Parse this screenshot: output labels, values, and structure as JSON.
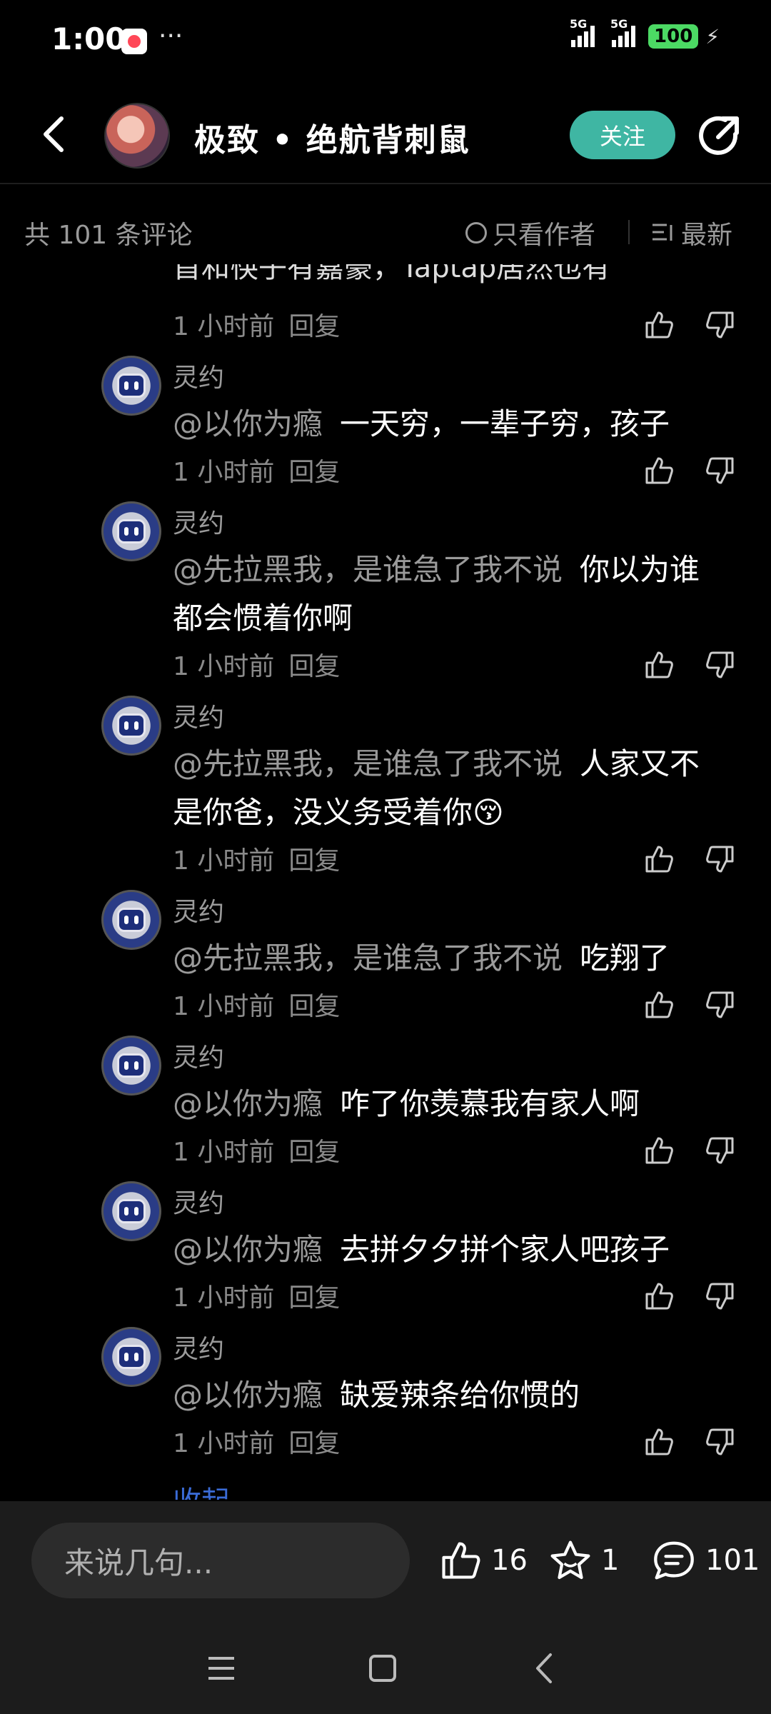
{
  "status": {
    "time": "1:00",
    "more": "···",
    "network1": "5G",
    "network2": "5G",
    "battery": "100"
  },
  "header": {
    "title": "极致 • 绝航背刺鼠",
    "follow_label": "关注"
  },
  "comments_header": {
    "count": "共 101 条评论",
    "author_only": "只看作者",
    "sort": "最新"
  },
  "partial": {
    "text": "首和筷子有嘉豪，Taptap居然也有"
  },
  "meta": {
    "time": "1 小时前",
    "reply": "回复"
  },
  "replies": [
    {
      "name": "灵约",
      "mention": "@以你为瘾",
      "text": "一天穷，一辈子穷，孩子"
    },
    {
      "name": "灵约",
      "mention": "@先拉黑我，是谁急了我不说",
      "text": "你以为谁都会惯着你啊"
    },
    {
      "name": "灵约",
      "mention": "@先拉黑我，是谁急了我不说",
      "text": "人家又不是你爸，没义务受着你😚"
    },
    {
      "name": "灵约",
      "mention": "@先拉黑我，是谁急了我不说",
      "text": "吃翔了"
    },
    {
      "name": "灵约",
      "mention": "@以你为瘾",
      "text": "咋了你羡慕我有家人啊"
    },
    {
      "name": "灵约",
      "mention": "@以你为瘾",
      "text": "去拼夕夕拼个家人吧孩子"
    },
    {
      "name": "灵约",
      "mention": "@以你为瘾",
      "text": "缺爱辣条给你惯的"
    }
  ],
  "collapse_label": "收起",
  "bottom": {
    "input_placeholder": "来说几句...",
    "likes": "16",
    "favorites": "1",
    "comments": "101"
  },
  "colors": {
    "accent": "#3fb6a3",
    "link": "#3a6bd6",
    "muted": "#9a9a9a"
  }
}
